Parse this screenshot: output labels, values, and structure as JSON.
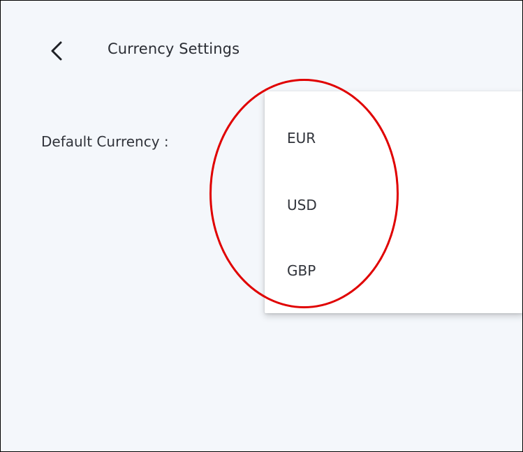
{
  "header": {
    "back_icon": "chevron-left-icon",
    "title": "Currency Settings"
  },
  "settings": {
    "default_currency_label": "Default Currency :"
  },
  "dropdown": {
    "options": [
      "EUR",
      "USD",
      "GBP"
    ]
  },
  "colors": {
    "background": "#f4f7fb",
    "menu_background": "#ffffff",
    "text": "#30333a",
    "annotation": "#e00000"
  }
}
